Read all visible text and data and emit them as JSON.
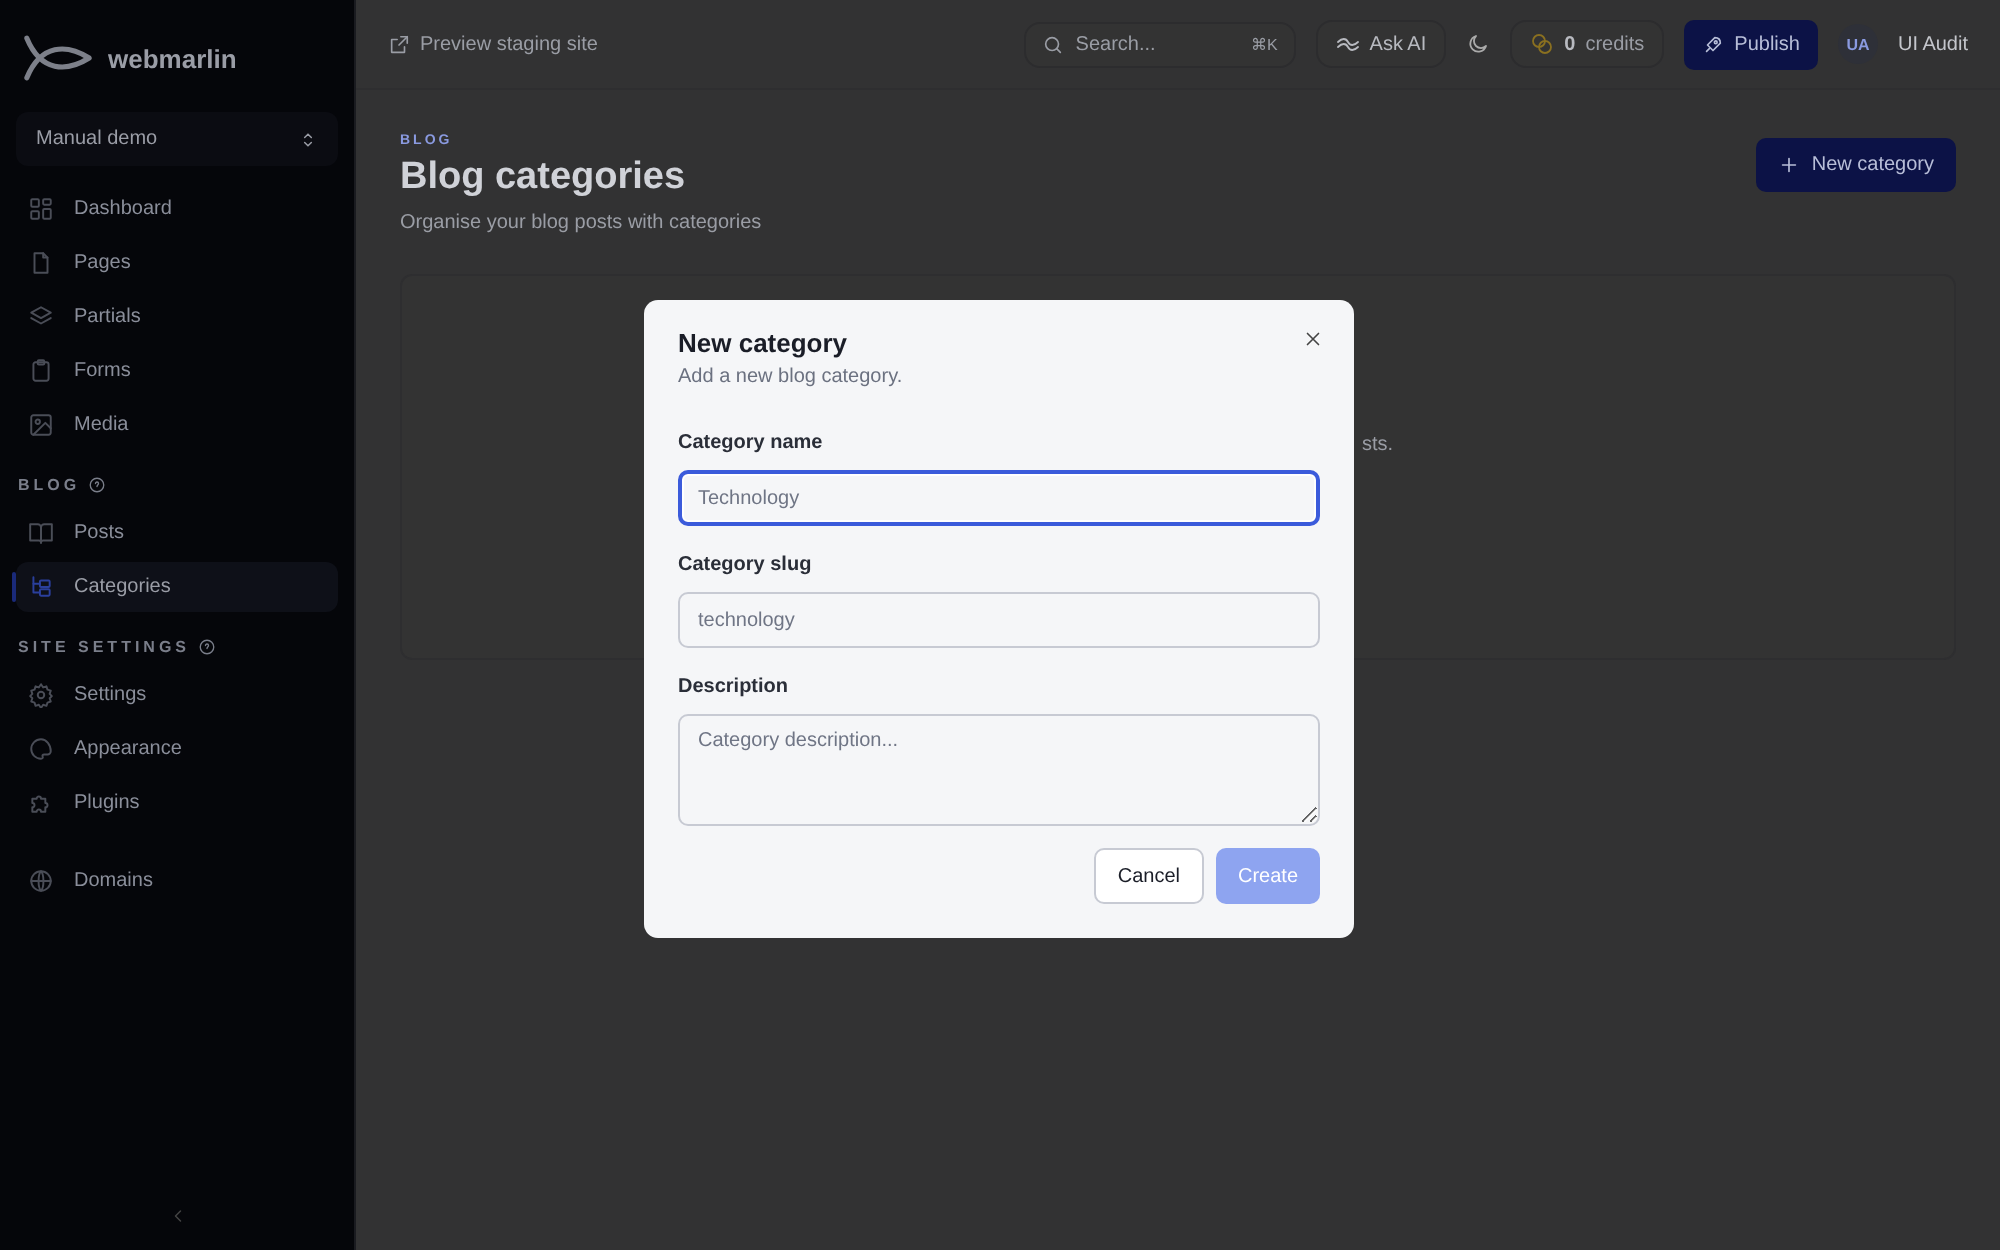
{
  "sidebar": {
    "logo": "webmarlin",
    "site_selector": "Manual demo",
    "sections": [
      {
        "items": [
          {
            "label": "Dashboard",
            "selected": false
          },
          {
            "label": "Pages",
            "selected": false
          },
          {
            "label": "Partials",
            "selected": false
          },
          {
            "label": "Forms",
            "selected": false
          },
          {
            "label": "Media",
            "selected": false
          }
        ]
      },
      {
        "title": "BLOG",
        "items": [
          {
            "label": "Posts",
            "selected": false
          },
          {
            "label": "Categories",
            "selected": true
          }
        ]
      },
      {
        "title": "SITE SETTINGS",
        "items": [
          {
            "label": "Settings",
            "selected": false
          },
          {
            "label": "Appearance",
            "selected": false
          },
          {
            "label": "Plugins",
            "selected": false
          }
        ]
      },
      {
        "items": [
          {
            "label": "Domains",
            "selected": false
          }
        ]
      }
    ]
  },
  "header": {
    "preview_link": "Preview staging site",
    "search": {
      "placeholder": "Search...",
      "shortcut": "⌘K"
    },
    "ask_ai": "Ask AI",
    "credits": {
      "count": "0",
      "label": "credits"
    },
    "publish": "Publish",
    "avatar": "UA",
    "user": "UI Audit"
  },
  "page": {
    "eyebrow": "BLOG",
    "title": "Blog categories",
    "subtitle": "Organise your blog posts with categories",
    "new_button": "New category",
    "empty_text": "sts."
  },
  "modal": {
    "title": "New category",
    "subtitle": "Add a new blog category.",
    "fields": [
      {
        "kind": "input",
        "label": "Category name",
        "placeholder": "Technology",
        "focused": true
      },
      {
        "kind": "input",
        "label": "Category slug",
        "placeholder": "technology",
        "focused": false
      },
      {
        "kind": "textarea",
        "label": "Description",
        "placeholder": "Category description...",
        "focused": false
      }
    ],
    "buttons": [
      {
        "label": "Cancel",
        "kind": "secondary",
        "disabled": false
      },
      {
        "label": "Create",
        "kind": "primary",
        "disabled": true
      }
    ]
  }
}
